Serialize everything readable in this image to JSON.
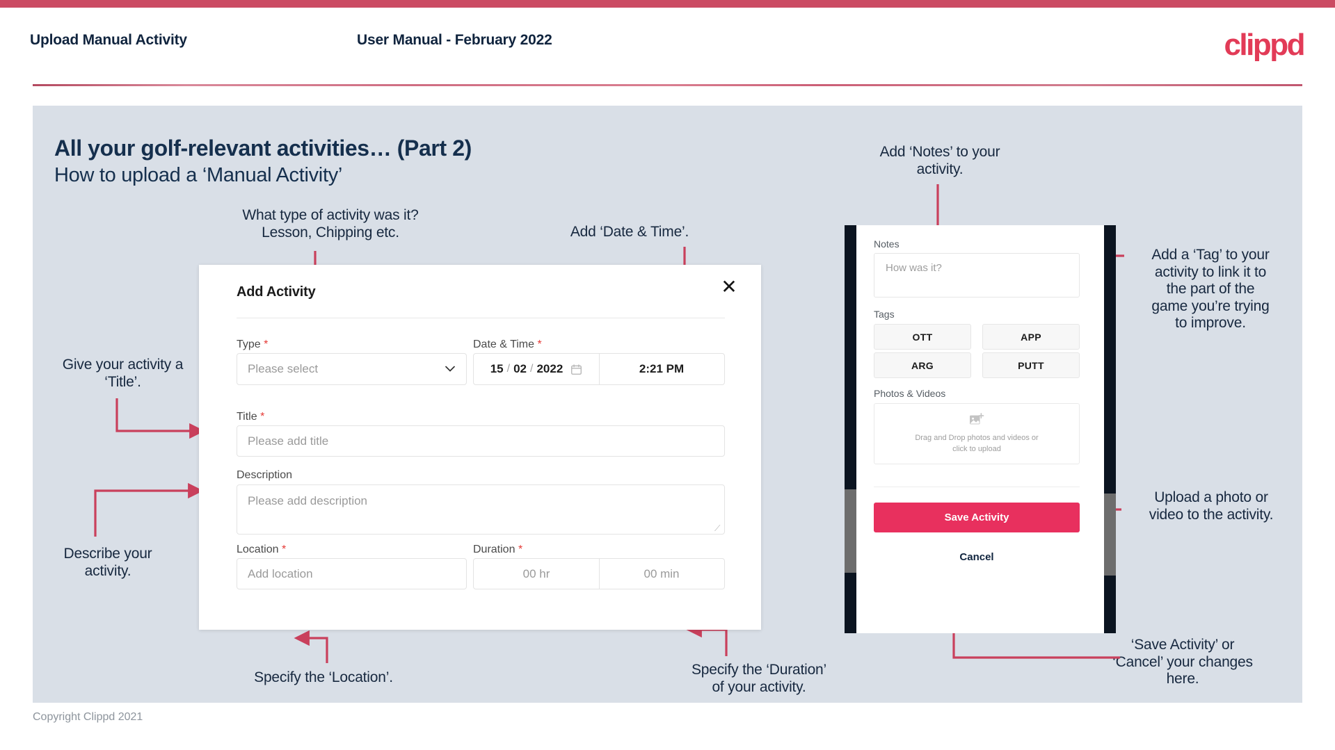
{
  "topbar": {
    "color": "#cb4b63"
  },
  "header": {
    "left_title": "Upload Manual Activity",
    "center_title": "User Manual - February 2022",
    "logo": "clippd"
  },
  "slide": {
    "title": "All your golf-relevant activities… (Part 2)",
    "subtitle": "How to upload a ‘Manual Activity’"
  },
  "annotations": {
    "type": "What type of activity was it?\nLesson, Chipping etc.",
    "type_line1": "What type of activity was it?",
    "type_line2": "Lesson, Chipping etc.",
    "datetime": "Add ‘Date & Time’.",
    "notes": "Add ‘Notes’ to your\nactivity.",
    "notes_line1": "Add ‘Notes’ to your",
    "notes_line2": "activity.",
    "tag": "Add a ‘Tag’ to your activity to link it to the part of the game you’re trying to improve.",
    "tag_line1": "Add a ‘Tag’ to your",
    "tag_line2": "activity to link it to",
    "tag_line3": "the part of the",
    "tag_line4": "game you’re trying",
    "tag_line5": "to improve.",
    "title_field": "Give your activity a ‘Title’.",
    "title_field_line1": "Give your activity a",
    "title_field_line2": "‘Title’.",
    "describe": "Describe your activity.",
    "describe_line1": "Describe your",
    "describe_line2": "activity.",
    "upload": "Upload a photo or video to the activity.",
    "upload_line1": "Upload a photo or",
    "upload_line2": "video to the activity.",
    "location": "Specify the ‘Location’.",
    "duration_line1": "Specify the ‘Duration’",
    "duration_line2": "of your activity.",
    "save_cancel_line1": "‘Save Activity’ or",
    "save_cancel_line2": "‘Cancel’ your changes",
    "save_cancel_line3": "here."
  },
  "dialog": {
    "title": "Add Activity",
    "close_icon": "close-icon",
    "fields": {
      "type": {
        "label": "Type",
        "required": "*",
        "placeholder": "Please select",
        "icon": "chevron-down-icon"
      },
      "datetime": {
        "label": "Date & Time",
        "required": "*",
        "day": "15",
        "sep1": "/",
        "month": "02",
        "sep2": "/",
        "year": "2022",
        "calendar_icon": "calendar-icon",
        "time": "2:21 PM"
      },
      "title": {
        "label": "Title",
        "required": "*",
        "placeholder": "Please add title"
      },
      "description": {
        "label": "Description",
        "required": "",
        "placeholder": "Please add description"
      },
      "location": {
        "label": "Location",
        "required": "*",
        "placeholder": "Add location"
      },
      "duration": {
        "label": "Duration",
        "required": "*",
        "hours_placeholder": "00 hr",
        "minutes_placeholder": "00 min"
      }
    }
  },
  "phone": {
    "notes": {
      "label": "Notes",
      "placeholder": "How was it?"
    },
    "tags": {
      "label": "Tags",
      "items": [
        "OTT",
        "APP",
        "ARG",
        "PUTT"
      ]
    },
    "photos": {
      "label": "Photos & Videos",
      "icon": "add-image-icon",
      "hint_line1": "Drag and Drop photos and videos or",
      "hint_line2": "click to upload"
    },
    "save_label": "Save Activity",
    "cancel_label": "Cancel",
    "save_color": "#e8305e"
  },
  "footer": {
    "copyright": "Copyright Clippd 2021"
  }
}
